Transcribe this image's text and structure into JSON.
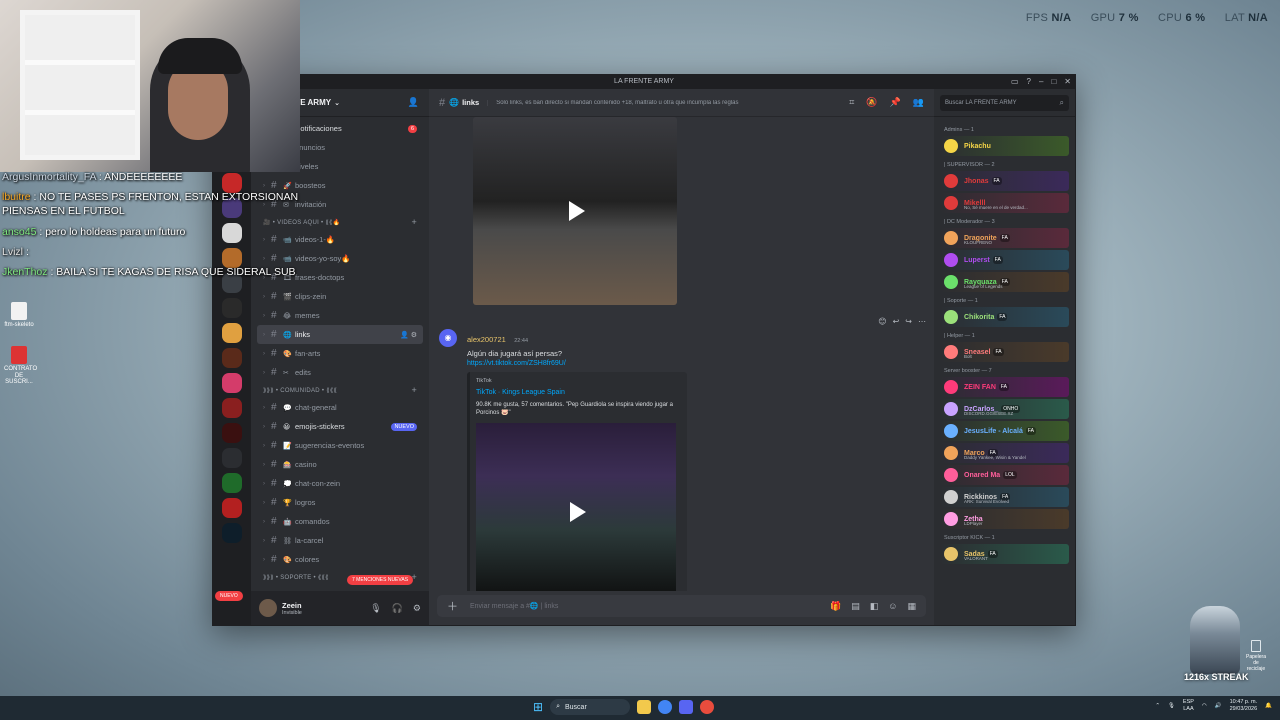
{
  "overlay": {
    "fps_label": "FPS",
    "fps_value": "N/A",
    "gpu_label": "GPU",
    "gpu_value": "7 %",
    "cpu_label": "CPU",
    "cpu_value": "6 %",
    "lat_label": "LAT",
    "lat_value": "N/A"
  },
  "stream_chat": [
    {
      "user": "ArgusInmortality_FA",
      "text": ": ANDEEEEEEEE"
    },
    {
      "user": "lbuitre",
      "text": ": NO TE PASES PS FRENTON, ESTAN EXTORSIONAN PIENSAS EN EL FUTBOL"
    },
    {
      "user": "anso45",
      "text": ": pero lo holdeas para un futuro"
    },
    {
      "user": "Lvizl",
      "text": ":"
    },
    {
      "user": "JkenThoz",
      "text": ": BAILA SI TE KAGAS DE RISA QUE SIDERAL SUB"
    }
  ],
  "desktop_icons": [
    {
      "label": "ftm-skeleto"
    },
    {
      "label": "CONTRATO DE SUSCRI..."
    }
  ],
  "window": {
    "title": "LA FRENTE ARMY"
  },
  "server": {
    "name": "LA FRENTE ARMY"
  },
  "channels": [
    {
      "type": "channel",
      "emoji": "🔔",
      "name": "Notificaciones",
      "badge": "6"
    },
    {
      "type": "channel",
      "emoji": "📢",
      "name": "anuncios"
    },
    {
      "type": "channel",
      "emoji": "⭐",
      "name": "niveles"
    },
    {
      "type": "channel",
      "emoji": "🚀",
      "name": "boosteos"
    },
    {
      "type": "channel",
      "emoji": "✉",
      "name": "invitación"
    },
    {
      "type": "category",
      "name": "🎥 • VIDEOS AQUI • ⟪⟪🔥"
    },
    {
      "type": "channel",
      "emoji": "📹",
      "name": "videos-1-🔥"
    },
    {
      "type": "channel",
      "emoji": "📹",
      "name": "videos-yo-soy🔥"
    },
    {
      "type": "channel",
      "emoji": "🎞",
      "name": "frases-doctops"
    },
    {
      "type": "channel",
      "emoji": "🎬",
      "name": "clips-zein"
    },
    {
      "type": "channel",
      "emoji": "😂",
      "name": "memes"
    },
    {
      "type": "channel",
      "emoji": "🌐",
      "name": "links",
      "active": true
    },
    {
      "type": "channel",
      "emoji": "🎨",
      "name": "fan-arts"
    },
    {
      "type": "channel",
      "emoji": "✂",
      "name": "edits"
    },
    {
      "type": "category",
      "name": "⟫⟫⟫ • COMUNIDAD • ⟪⟪⟪"
    },
    {
      "type": "channel",
      "emoji": "💬",
      "name": "chat-general"
    },
    {
      "type": "channel",
      "emoji": "😀",
      "name": "emojis-stickers",
      "badge": "NUEVO"
    },
    {
      "type": "channel",
      "emoji": "📝",
      "name": "sugerencias-eventos"
    },
    {
      "type": "channel",
      "emoji": "🎰",
      "name": "casino"
    },
    {
      "type": "channel",
      "emoji": "💭",
      "name": "chat-con-zein"
    },
    {
      "type": "channel",
      "emoji": "🏆",
      "name": "logros"
    },
    {
      "type": "channel",
      "emoji": "🤖",
      "name": "comandos"
    },
    {
      "type": "channel",
      "emoji": "⛓",
      "name": "la-carcel"
    },
    {
      "type": "channel",
      "emoji": "🎨",
      "name": "colores"
    },
    {
      "type": "category",
      "name": "⟫⟫⟫ • SOPORTE • ⟪⟪⟪"
    }
  ],
  "guild_pills": {
    "new": "NUEVO",
    "mentions": "7 MENCIONES NUEVAS"
  },
  "user": {
    "name": "Zeein",
    "status": "Invisible"
  },
  "channel_header": {
    "name": "links",
    "topic": "Solo links, es ban directo si mandan contenido +18, maltrato u otra que incumpla las reglas"
  },
  "message": {
    "author": "alex200721",
    "time": "22:44",
    "text": "Algún dia jugará así persas?",
    "link": "https://vt.tiktok.com/ZSH8fr69U/",
    "embed": {
      "provider": "TikTok",
      "title": "TikTok · Kings League Spain",
      "description": "90.8K me gusta, 57 comentarios. \"Pep Guardiola se inspira viendo jugar a Porcinos 🐷\""
    }
  },
  "composer": {
    "placeholder": "Enviar mensaje a #🌐 | links"
  },
  "members_search": {
    "placeholder": "Buscar LA FRENTE ARMY"
  },
  "member_groups": [
    {
      "role": "Admins — 1",
      "members": [
        {
          "name": "Pikachu",
          "tag": "",
          "sub": "",
          "color": "#f5d547"
        }
      ]
    },
    {
      "role": "| SUPERVISOR — 2",
      "members": [
        {
          "name": "Jhonas",
          "tag": "FA",
          "sub": "",
          "color": "#e03b3b"
        },
        {
          "name": "Mikelll",
          "tag": "",
          "sub": "No, Sé muere en el de verdad...",
          "color": "#e03b3b"
        }
      ]
    },
    {
      "role": "| DC Moderador — 3",
      "members": [
        {
          "name": "Dragonite",
          "tag": "FA",
          "sub": "KLOUFRENO",
          "color": "#f0a35a"
        },
        {
          "name": "Luperst",
          "tag": "FA",
          "sub": "",
          "color": "#b04df0"
        },
        {
          "name": "Rayquaza",
          "tag": "FA",
          "sub": "League of Legends",
          "color": "#6be06b"
        }
      ]
    },
    {
      "role": "| Soporte — 1",
      "members": [
        {
          "name": "Chikorita",
          "tag": "FA",
          "sub": "",
          "color": "#9be07a"
        }
      ]
    },
    {
      "role": "| Helper — 1",
      "members": [
        {
          "name": "Sneasel",
          "tag": "FA",
          "sub": "Bolt",
          "color": "#ff7b7b"
        }
      ]
    },
    {
      "role": "Server booster — 7",
      "members": [
        {
          "name": "ZEIN FAN",
          "tag": "FA",
          "sub": "",
          "color": "#ff3b7a"
        },
        {
          "name": "DzCarlos_",
          "tag": "ONHO",
          "sub": "DISCORD.GG/ESEE.XZ",
          "color": "#c8a2ff"
        },
        {
          "name": "JesusLife - Alcalá",
          "tag": "FA",
          "sub": "",
          "color": "#6ab0ff"
        },
        {
          "name": "Marco",
          "tag": "FA",
          "sub": "Daddy Yankee, Wisin & Yandel",
          "color": "#f0a35a"
        },
        {
          "name": "Onared Ma",
          "tag": "LOL",
          "sub": "",
          "color": "#ff5e9a"
        },
        {
          "name": "Rickkinos",
          "tag": "FA",
          "sub": "ARK: Survival Evolved",
          "color": "#d0d0d0"
        },
        {
          "name": "Zetha",
          "tag": "",
          "sub": "LDPlayer",
          "color": "#ff9de2"
        }
      ]
    },
    {
      "role": "Suscriptor KICK — 1",
      "members": [
        {
          "name": "Sadas",
          "tag": "FA",
          "sub": "VALORANT",
          "color": "#e8c46a"
        }
      ]
    }
  ],
  "streak": {
    "text": "1216x STREAK"
  },
  "recycle_bin": {
    "label": "Papelera de reciclaje"
  },
  "taskbar": {
    "search": "Buscar",
    "lang": "ESP",
    "lang2": "LAA",
    "time": "10:47 p. m.",
    "date": "29/03/2026"
  },
  "colors": {
    "discord_bg": "#313338",
    "discord_sidebar": "#2b2d31",
    "discord_dark": "#1e1f22",
    "link": "#00a8fc",
    "accent": "#5865f2",
    "mention_red": "#f23f43"
  }
}
